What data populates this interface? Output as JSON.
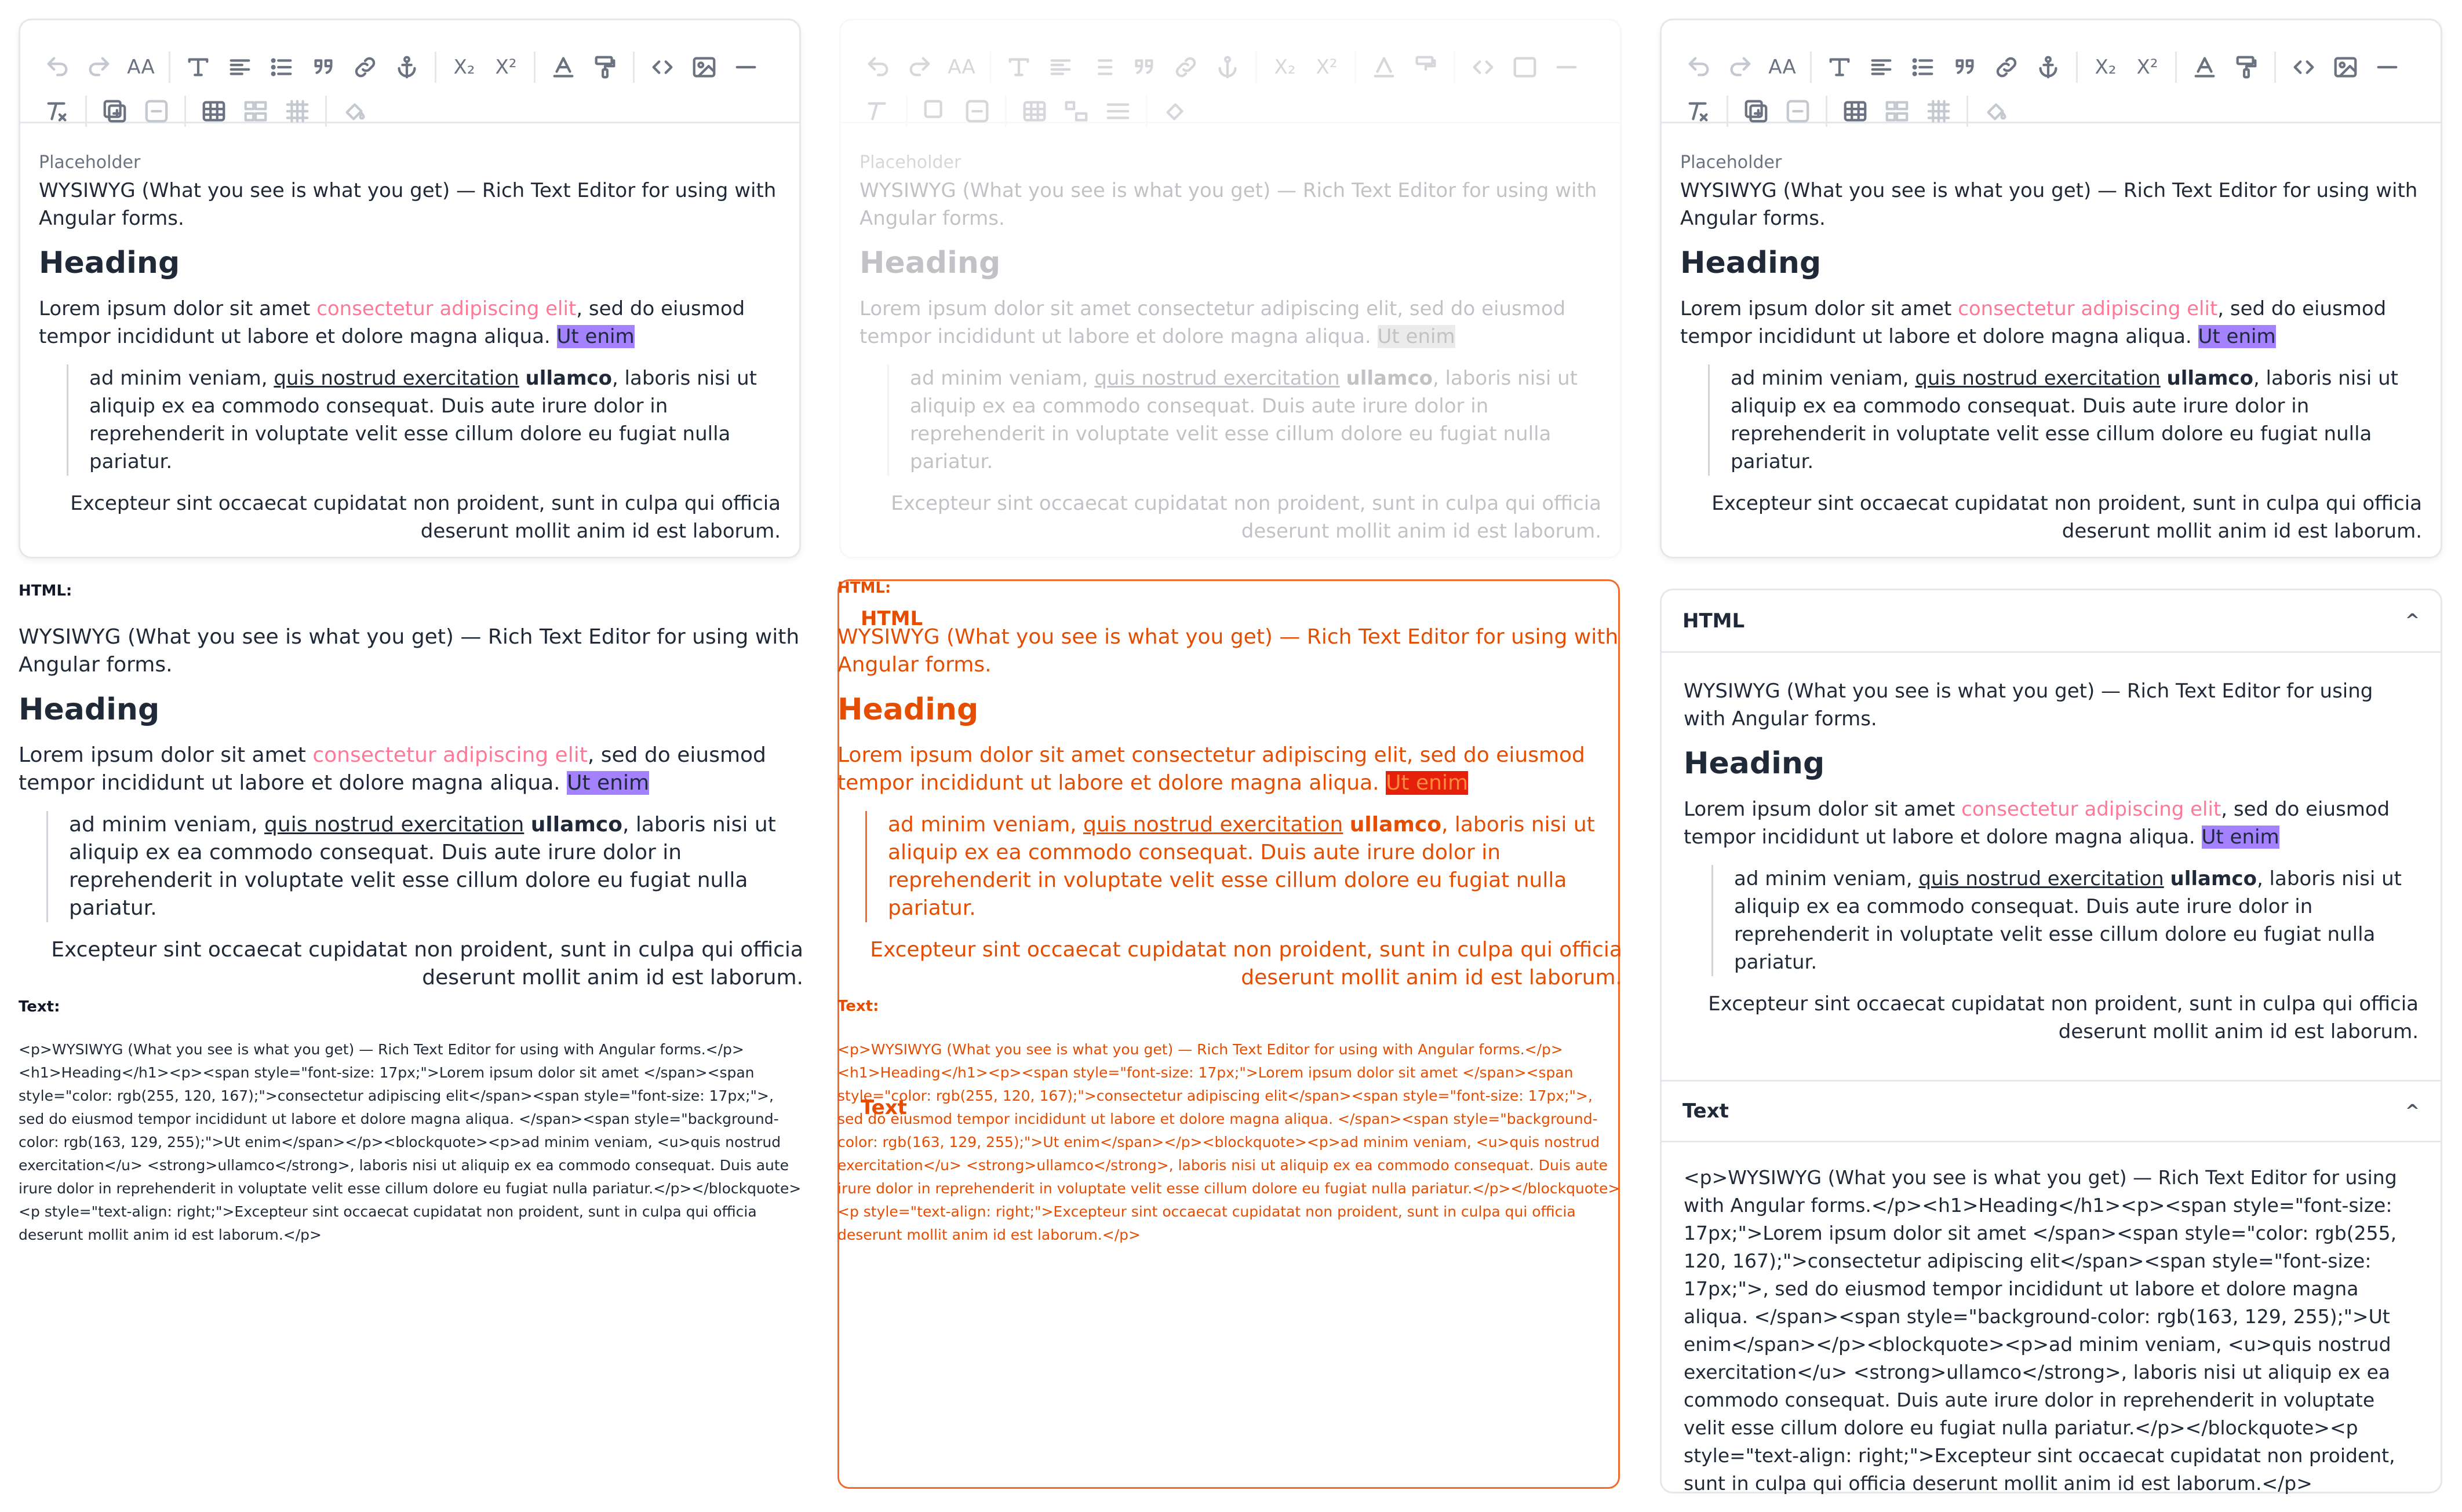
{
  "toolbar": {
    "row1": [
      "undo-icon",
      "redo-icon",
      "text-size-icon",
      "text-format-icon",
      "align-icon",
      "bullet-list-icon",
      "blockquote-icon",
      "link-icon",
      "anchor-icon",
      "subscript-icon",
      "superscript-icon",
      "text-color-icon",
      "paint-roller-icon",
      "code-icon",
      "image-icon",
      "horizontal-rule-icon"
    ],
    "row2": [
      "clear-format-icon",
      "add-table-icon",
      "remove-icon",
      "table-icon",
      "table-rows-icon",
      "table-grid-icon",
      "eraser-bucket-icon"
    ],
    "size_label": "AA",
    "sub_label": "X₂",
    "sup_label": "X²"
  },
  "editor": {
    "placeholder": "Placeholder",
    "intro": "WYSIWYG (What you see is what you get) — Rich Text Editor for using with Angular forms.",
    "heading": "Heading",
    "p_start": "Lorem ipsum dolor sit amet ",
    "p_pink": "consectetur adipiscing elit",
    "p_mid": ", sed do eiusmod tempor incididunt ut labore et dolore magna aliqua. ",
    "p_hl": "Ut enim",
    "bq_start": "ad minim veniam, ",
    "bq_u": "quis nostrud exercitation",
    "bq_space": " ",
    "bq_b": "ullamco",
    "bq_end": ", laboris nisi ut aliquip ex ea commodo consequat. Duis aute irure dolor in reprehenderit in voluptate velit esse cillum dolore eu fugiat nulla pariatur.",
    "right": "Excepteur sint occaecat cupidatat non proident, sunt in culpa qui officia deserunt mollit anim id est laborum."
  },
  "labels": {
    "html": "HTML:",
    "text": "Text:",
    "acc_html": "HTML",
    "acc_text": "Text",
    "chevron": "^"
  },
  "source": "<p>WYSIWYG (What you see is what you get) — Rich Text Editor for using with Angular forms.</p><h1>Heading</h1><p><span style=\"font-size: 17px;\">Lorem ipsum dolor sit amet </span><span style=\"color: rgb(255, 120, 167);\">consectetur adipiscing elit</span><span style=\"font-size: 17px;\">, sed do eiusmod tempor incididunt ut labore et dolore magna aliqua. </span><span style=\"background-color: rgb(163, 129, 255);\">Ut enim</span></p><blockquote><p>ad minim veniam, <u>quis nostrud exercitation</u> <strong>ullamco</strong>, laboris nisi ut aliquip ex ea commodo consequat. Duis aute irure dolor in reprehenderit in voluptate velit esse cillum dolore eu fugiat nulla pariatur.</p></blockquote><p style=\"text-align: right;\">Excepteur sint occaecat cupidatat non proident, sunt in culpa qui officia deserunt mollit anim id est laborum.</p>",
  "colors": {
    "pink": "#ff7897",
    "highlight": "#a381ff",
    "overlay_accent": "#e54d00"
  }
}
